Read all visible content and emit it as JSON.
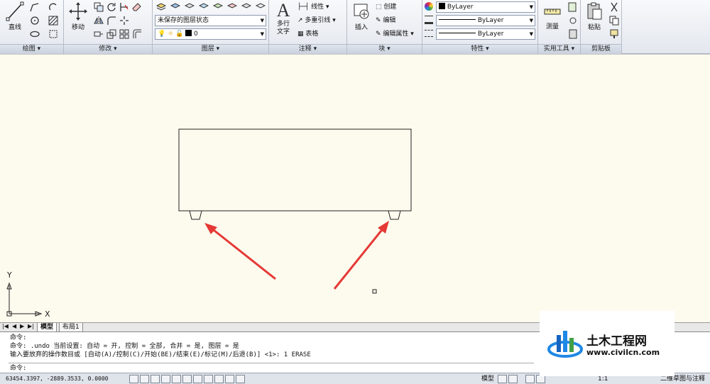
{
  "ribbon": {
    "draw_panel": {
      "title": "绘图 ▾",
      "line_label": "直线"
    },
    "modify_panel": {
      "title": "修改 ▾",
      "move_label": "移动"
    },
    "layers_panel": {
      "title": "图层 ▾",
      "state_value": "未保存的图层状态",
      "layer_value": "0"
    },
    "annotation_panel": {
      "title": "注释 ▾",
      "mtext_label": "多行文字",
      "linear_label": "线性",
      "mleader_label": "多重引线",
      "table_label": "表格"
    },
    "block_panel": {
      "title": "块 ▾",
      "insert_label": "插入",
      "create_label": "创建",
      "edit_label": "编辑",
      "edit_attr_label": "编辑属性"
    },
    "properties_panel": {
      "title": "特性 ▾",
      "color_value": "ByLayer",
      "linetype_value": "ByLayer",
      "lineweight_value": "ByLayer"
    },
    "utilities_panel": {
      "title": "实用工具 ▾",
      "measure_label": "测量"
    },
    "clipboard_panel": {
      "title": "剪贴板",
      "paste_label": "粘贴"
    }
  },
  "canvas": {
    "background": "#fdfbee",
    "arrow_color": "#e53935",
    "ucs_x": "X",
    "ucs_y": "Y"
  },
  "tabs": {
    "model": "模型",
    "layout1": "布局1"
  },
  "command": {
    "line1": "命令:",
    "line2": "命令:  .undo 当前设置: 自动 = 开, 控制 = 全部, 合并 = 是, 图层 = 是",
    "line3": "输入要放弃的操作数目或 [自动(A)/控制(C)/开始(BE)/结束(E)/标记(M)/后退(B)] <1>: 1 ERASE",
    "prompt": "命令:"
  },
  "status": {
    "coords": "63454.3397, -2889.3533, 0.0000",
    "model_label": "模型",
    "scale": "1:1",
    "workspace": "二维草图与注释"
  },
  "watermark": {
    "brand_text": "土木工程网",
    "url_text": "www.civilcn.com"
  }
}
